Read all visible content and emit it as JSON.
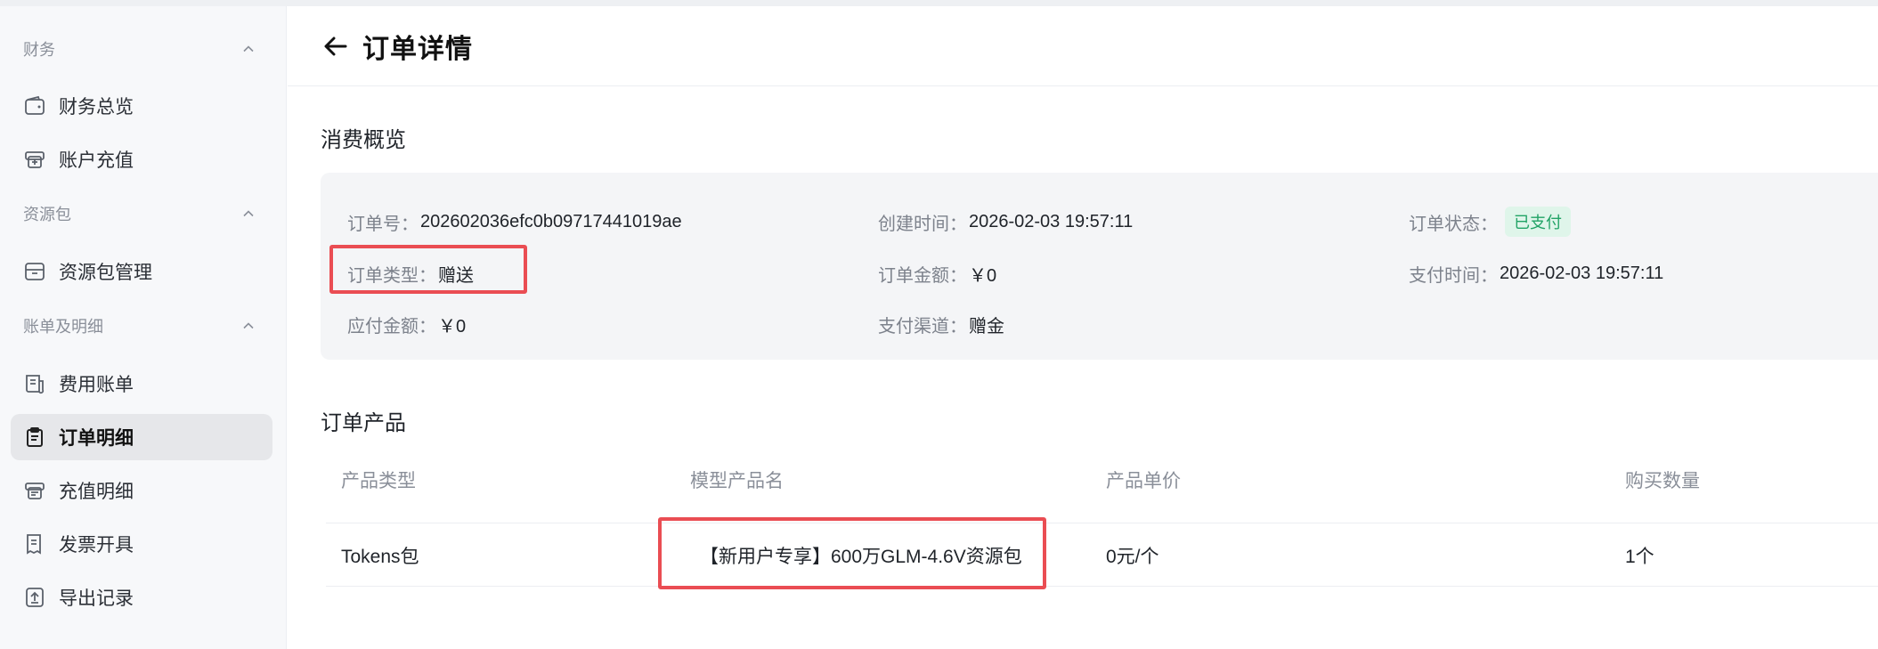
{
  "sidebar": {
    "sections": [
      {
        "label": "财务",
        "items": [
          {
            "label": "财务总览",
            "icon": "wallet-icon"
          },
          {
            "label": "账户充值",
            "icon": "recharge-icon"
          }
        ]
      },
      {
        "label": "资源包",
        "items": [
          {
            "label": "资源包管理",
            "icon": "package-icon"
          }
        ]
      },
      {
        "label": "账单及明细",
        "items": [
          {
            "label": "费用账单",
            "icon": "bill-icon"
          },
          {
            "label": "订单明细",
            "icon": "clipboard-icon",
            "active": true
          },
          {
            "label": "充值明细",
            "icon": "recharge-detail-icon"
          },
          {
            "label": "发票开具",
            "icon": "invoice-icon"
          },
          {
            "label": "导出记录",
            "icon": "export-icon"
          }
        ]
      }
    ]
  },
  "header": {
    "title": "订单详情"
  },
  "summary": {
    "title": "消费概览",
    "order_no_label": "订单号：",
    "order_no": "202602036efc0b09717441019ae",
    "created_label": "创建时间：",
    "created": "2026-02-03 19:57:11",
    "status_label": "订单状态：",
    "status": "已支付",
    "type_label": "订单类型：",
    "type": "赠送",
    "amount_label": "订单金额：",
    "amount": "￥0",
    "paid_time_label": "支付时间：",
    "paid_time": "2026-02-03 19:57:11",
    "payable_label": "应付金额：",
    "payable": "￥0",
    "channel_label": "支付渠道：",
    "channel": "赠金"
  },
  "products": {
    "title": "订单产品",
    "columns": [
      "产品类型",
      "模型产品名",
      "产品单价",
      "购买数量"
    ],
    "rows": [
      [
        "Tokens包",
        "【新用户专享】600万GLM-4.6V资源包",
        "0元/个",
        "1个"
      ]
    ]
  },
  "colors": {
    "accent_highlight": "#ea4d53",
    "status_paid": "#21a366",
    "active_nav_bg": "#e6e7ea"
  }
}
